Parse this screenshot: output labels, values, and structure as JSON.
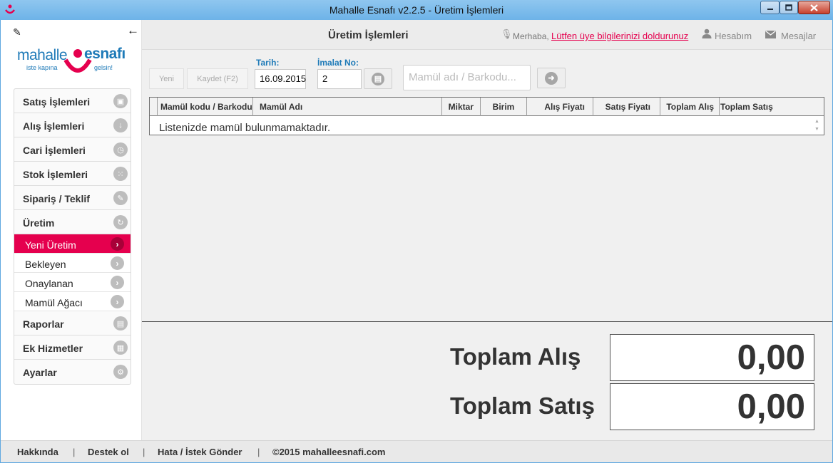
{
  "window": {
    "title": "Mahalle Esnafı v2.2.5 - Üretim İşlemleri"
  },
  "brand": {
    "word1": "mahalle",
    "word2": "esnafı",
    "tagline1": "iste kapına",
    "tagline2": "gelsin!",
    "pink": "#e5004e",
    "blue": "#1e7ab8"
  },
  "sidebar": {
    "menu": [
      {
        "label": "Satış İşlemleri",
        "icon": "bag-icon"
      },
      {
        "label": "Alış İşlemleri",
        "icon": "download-icon"
      },
      {
        "label": "Cari İşlemleri",
        "icon": "clock-icon"
      },
      {
        "label": "Stok İşlemleri",
        "icon": "grid-icon"
      },
      {
        "label": "Sipariş / Teklif",
        "icon": "pencil-icon"
      },
      {
        "label": "Üretim",
        "icon": "refresh-icon"
      }
    ],
    "submenu": [
      {
        "label": "Yeni Üretim",
        "active": true
      },
      {
        "label": "Bekleyen",
        "active": false
      },
      {
        "label": "Onaylanan",
        "active": false
      },
      {
        "label": "Mamül Ağacı",
        "active": false
      }
    ],
    "menu_bottom": [
      {
        "label": "Raporlar",
        "icon": "report-icon"
      },
      {
        "label": "Ek Hizmetler",
        "icon": "calendar-icon"
      },
      {
        "label": "Ayarlar",
        "icon": "gear-icon"
      }
    ]
  },
  "header": {
    "title": "Üretim İşlemleri",
    "greeting": "Merhaba,",
    "profile_link": "Lütfen üye bilgilerinizi doldurunuz",
    "account": "Hesabım",
    "messages": "Mesajlar"
  },
  "toolbar": {
    "new_label": "Yeni",
    "save_label": "Kaydet (F2)",
    "date_label": "Tarih:",
    "date_value": "16.09.2015",
    "batch_label": "İmalat No:",
    "batch_value": "2",
    "search_placeholder": "Mamül adı / Barkodu..."
  },
  "table": {
    "columns": [
      "Mamül kodu / Barkodu",
      "Mamül Adı",
      "Miktar",
      "Birim",
      "Alış Fiyatı",
      "Satış Fiyatı",
      "Toplam Alış",
      "Toplam Satış"
    ],
    "empty_message": "Listenizde mamül bulunmamaktadır."
  },
  "totals": {
    "purchase_label": "Toplam Alış",
    "purchase_value": "0,00",
    "sale_label": "Toplam Satış",
    "sale_value": "0,00"
  },
  "footer": {
    "about": "Hakkında",
    "support": "Destek ol",
    "report": "Hata / İstek Gönder",
    "copyright": "©2015 mahalleesnafi.com",
    "separator": "|"
  }
}
